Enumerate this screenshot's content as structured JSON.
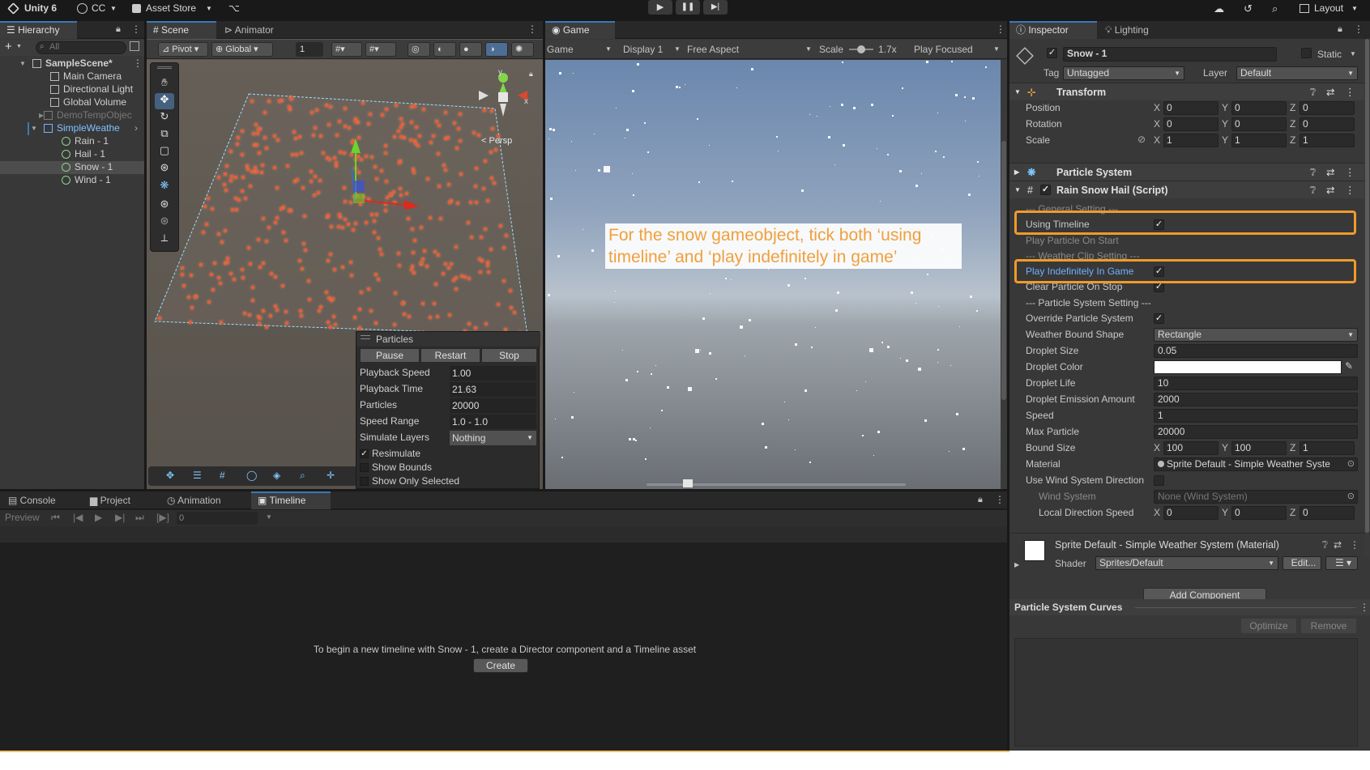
{
  "topbar": {
    "app": "Unity 6",
    "account": "CC",
    "asset_store": "Asset Store",
    "layout": "Layout"
  },
  "hierarchy": {
    "tab": "Hierarchy",
    "search_placeholder": "All",
    "items": [
      {
        "label": "SampleScene*",
        "bold": true
      },
      {
        "label": "Main Camera"
      },
      {
        "label": "Directional Light"
      },
      {
        "label": "Global Volume"
      },
      {
        "label": "DemoTempObjec"
      },
      {
        "label": "SimpleWeathe"
      },
      {
        "label": "Rain - 1"
      },
      {
        "label": "Hail - 1"
      },
      {
        "label": "Snow - 1"
      },
      {
        "label": "Wind - 1"
      }
    ]
  },
  "scene": {
    "tabs": [
      "Scene",
      "Animator"
    ],
    "pivot": "Pivot",
    "global": "Global",
    "grid_value": "1",
    "gizmo_label": "< Persp",
    "gizmo_axes": {
      "y": "y",
      "x": "x"
    }
  },
  "particles_overlay": {
    "title": "Particles",
    "buttons": [
      "Pause",
      "Restart",
      "Stop"
    ],
    "rows": [
      {
        "label": "Playback Speed",
        "value": "1.00"
      },
      {
        "label": "Playback Time",
        "value": "21.63"
      },
      {
        "label": "Particles",
        "value": "20000"
      },
      {
        "label": "Speed Range",
        "value": "1.0 - 1.0"
      },
      {
        "label": "Simulate Layers",
        "value": "Nothing"
      }
    ],
    "checks": [
      {
        "label": "Resimulate",
        "checked": true
      },
      {
        "label": "Show Bounds",
        "checked": false
      },
      {
        "label": "Show Only Selected",
        "checked": false
      }
    ]
  },
  "game": {
    "tab": "Game",
    "mode": "Game",
    "display": "Display 1",
    "aspect": "Free Aspect",
    "scale_label": "Scale",
    "scale_value": "1.7x",
    "focus": "Play Focused",
    "annotation": "For the snow gameobject, tick both ‘using timeline’ and ‘play indefinitely in game’"
  },
  "bottom": {
    "tabs": [
      "Console",
      "Project",
      "Animation",
      "Timeline"
    ],
    "preview": "Preview",
    "frame": "0",
    "message": "To begin a new timeline with Snow - 1, create a Director component and a Timeline asset",
    "create_button": "Create"
  },
  "inspector": {
    "tabs": [
      "Inspector",
      "Lighting"
    ],
    "object_name": "Snow - 1",
    "static_label": "Static",
    "tag_label": "Tag",
    "tag_value": "Untagged",
    "layer_label": "Layer",
    "layer_value": "Default",
    "transform": {
      "title": "Transform",
      "rows": [
        {
          "label": "Position",
          "x": "0",
          "y": "0",
          "z": "0"
        },
        {
          "label": "Rotation",
          "x": "0",
          "y": "0",
          "z": "0"
        },
        {
          "label": "Scale",
          "x": "1",
          "y": "1",
          "z": "1"
        }
      ]
    },
    "particle_system_title": "Particle System",
    "script_title": "Rain Snow Hail (Script)",
    "fields": {
      "general_header": "--- General Setting ---",
      "using_timeline": "Using Timeline",
      "play_particle_on_start": "Play Particle On Start",
      "weather_clip_header": "--- Weather Clip Setting ---",
      "play_indefinitely": "Play Indefinitely In Game",
      "clear_particle": "Clear Particle On Stop",
      "particle_system_header": "--- Particle System Setting ---",
      "override_particle_system": "Override Particle System",
      "weather_bound_shape": "Weather Bound Shape",
      "weather_bound_shape_value": "Rectangle",
      "droplet_size": "Droplet Size",
      "droplet_size_value": "0.05",
      "droplet_color": "Droplet Color",
      "droplet_color_value": "#ffffff",
      "droplet_life": "Droplet Life",
      "droplet_life_value": "10",
      "droplet_emission": "Droplet Emission Amount",
      "droplet_emission_value": "2000",
      "speed": "Speed",
      "speed_value": "1",
      "max_particle": "Max Particle",
      "max_particle_value": "20000",
      "bound_size": "Bound Size",
      "bound_x": "100",
      "bound_y": "100",
      "bound_z": "1",
      "material": "Material",
      "material_value": "Sprite Default - Simple Weather Syste",
      "use_wind": "Use Wind System Direction",
      "wind_system": "Wind System",
      "wind_system_value": "None (Wind System)",
      "local_direction_speed": "Local Direction Speed",
      "lds_x": "0",
      "lds_y": "0",
      "lds_z": "0"
    },
    "material_block": {
      "title": "Sprite Default - Simple Weather System (Material)",
      "shader_label": "Shader",
      "shader_value": "Sprites/Default",
      "edit_button": "Edit..."
    },
    "add_component": "Add Component",
    "curves": {
      "title": "Particle System Curves",
      "optimize": "Optimize",
      "remove": "Remove"
    }
  },
  "colors": {
    "highlight": "#f09a2a",
    "annotation_text": "#f0a03c",
    "selection_blue": "#3a79bb",
    "particle": "#e25a3c"
  }
}
